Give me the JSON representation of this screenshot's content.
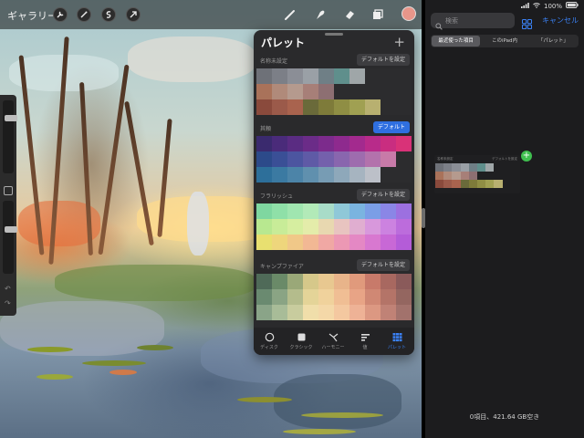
{
  "colors": {
    "accent_blue": "#3b82f6",
    "panel_bg": "#2a2a2c",
    "files_bg": "#1c1c1e",
    "add_green": "#3fbf4f"
  },
  "top_bar": {
    "gallery_label": "ギャラリー",
    "icons": [
      "wrench-icon",
      "magic-wand-icon",
      "selection-icon",
      "transform-arrow-icon",
      "brush-icon",
      "smudge-icon",
      "eraser-icon",
      "layers-icon",
      "color-swatch"
    ],
    "current_color": "#e8968a"
  },
  "sidebar": {
    "size_level": 0.78,
    "opacity_level": 0.62
  },
  "palette_panel": {
    "title": "パレット",
    "add_symbol": "+",
    "palettes": [
      {
        "name": "名称未設定",
        "button_label": "デフォルトを設定",
        "is_default": false,
        "swatches": [
          "#6e7178",
          "#7c7f87",
          "#8b8e96",
          "#9aa0a6",
          "#6f7f86",
          "#5f8f8c",
          "#9fa6a8",
          "#2c2c2e",
          "#2c2c2e",
          "#2c2c2e",
          "#a9725a",
          "#b08a7a",
          "#b59a8e",
          "#a77f78",
          "#8d6f72",
          "#2c2c2e",
          "#2c2c2e",
          "#2c2c2e",
          "#2c2c2e",
          "#2c2c2e",
          "#8a4a3c",
          "#9b5a4a",
          "#a9634e",
          "#6a6a3a",
          "#7e7b3a",
          "#8f8e44",
          "#a0a052",
          "#b8b070",
          "#2c2c2e",
          "#2c2c2e"
        ]
      },
      {
        "name": "其頼",
        "button_label": "デフォルト",
        "is_default": true,
        "swatches": [
          "#3a2a6e",
          "#4a2b7a",
          "#5a2c82",
          "#6b2c88",
          "#7c2b8c",
          "#8e2a8e",
          "#a32a8e",
          "#b82b8a",
          "#c92d80",
          "#d93278",
          "#2c4a8a",
          "#3a4f96",
          "#4c55a0",
          "#5f5aa6",
          "#7460ac",
          "#8966ae",
          "#9e6cae",
          "#b372ac",
          "#c87aa8",
          "#2c2c2e",
          "#2d6f9a",
          "#3b7aa2",
          "#4c84a8",
          "#6090ae",
          "#779cb4",
          "#8ea8ba",
          "#a6b4c0",
          "#bcc0c8",
          "#2c2c2e",
          "#2c2c2e"
        ]
      },
      {
        "name": "フラリッシュ",
        "button_label": "デフォルトを設定",
        "is_default": false,
        "swatches": [
          "#7fd7a0",
          "#8fe0a8",
          "#a0e6b0",
          "#b2eab8",
          "#a8dcc8",
          "#8fc8d8",
          "#7ab4e0",
          "#7a9ee6",
          "#8a86e6",
          "#9c70e0",
          "#b8e890",
          "#c8ec98",
          "#d6eea0",
          "#e4ecaa",
          "#e8d8b0",
          "#e8c4c0",
          "#e0aed0",
          "#d898dc",
          "#cc82e0",
          "#bc6cdc",
          "#e8e070",
          "#eed67c",
          "#f0c888",
          "#f2b894",
          "#f0a8a4",
          "#ec98b4",
          "#e488c4",
          "#d878d0",
          "#c868d6",
          "#b45cd8"
        ]
      },
      {
        "name": "キャンプファイア",
        "button_label": "デフォルトを設定",
        "is_default": false,
        "swatches": [
          "#4f6a58",
          "#6a8a68",
          "#9aa878",
          "#d6c88a",
          "#e8c890",
          "#e8b48a",
          "#e09a7c",
          "#c87a6a",
          "#a86860",
          "#8a5a5a",
          "#6a8a70",
          "#8aa484",
          "#b4bc8c",
          "#e4d498",
          "#f0d29c",
          "#f0be94",
          "#e8a486",
          "#d08874",
          "#b47468",
          "#946660",
          "#8aa488",
          "#a8bc98",
          "#c8cc9e",
          "#f0deaa",
          "#f4d8a8",
          "#f4c8a0",
          "#eeb296",
          "#dc9882",
          "#c08276",
          "#a2726c"
        ]
      }
    ],
    "tabs": [
      {
        "label": "ディスク",
        "icon": "disc-icon"
      },
      {
        "label": "クラシック",
        "icon": "square-icon"
      },
      {
        "label": "ハーモニー",
        "icon": "harmony-icon"
      },
      {
        "label": "値",
        "icon": "sliders-icon"
      },
      {
        "label": "パレット",
        "icon": "palette-grid-icon",
        "active": true
      }
    ]
  },
  "files": {
    "status": {
      "battery": "100%"
    },
    "search_placeholder": "検索",
    "cancel_label": "キャンセル",
    "scopes": [
      {
        "label": "最近使った項目",
        "active": true
      },
      {
        "label": "このiPad内",
        "active": false
      },
      {
        "label": "「パレット」",
        "active": false
      }
    ],
    "drag_preview": {
      "name_left": "名称未設定",
      "name_right": "デフォルトを設定",
      "add_symbol": "+",
      "swatches": [
        "#6e7178",
        "#7c7f87",
        "#8b8e96",
        "#9aa0a6",
        "#6f7f86",
        "#5f8f8c",
        "#9fa6a8",
        "#1f1f21",
        "#1f1f21",
        "#1f1f21",
        "#a9725a",
        "#b08a7a",
        "#b59a8e",
        "#a77f78",
        "#8d6f72",
        "#1f1f21",
        "#1f1f21",
        "#1f1f21",
        "#1f1f21",
        "#1f1f21",
        "#8a4a3c",
        "#9b5a4a",
        "#a9634e",
        "#6a6a3a",
        "#7e7b3a",
        "#8f8e44",
        "#a0a052",
        "#b8b070",
        "#1f1f21",
        "#1f1f21"
      ]
    },
    "footer": "0項目、421.64 GB空き"
  }
}
